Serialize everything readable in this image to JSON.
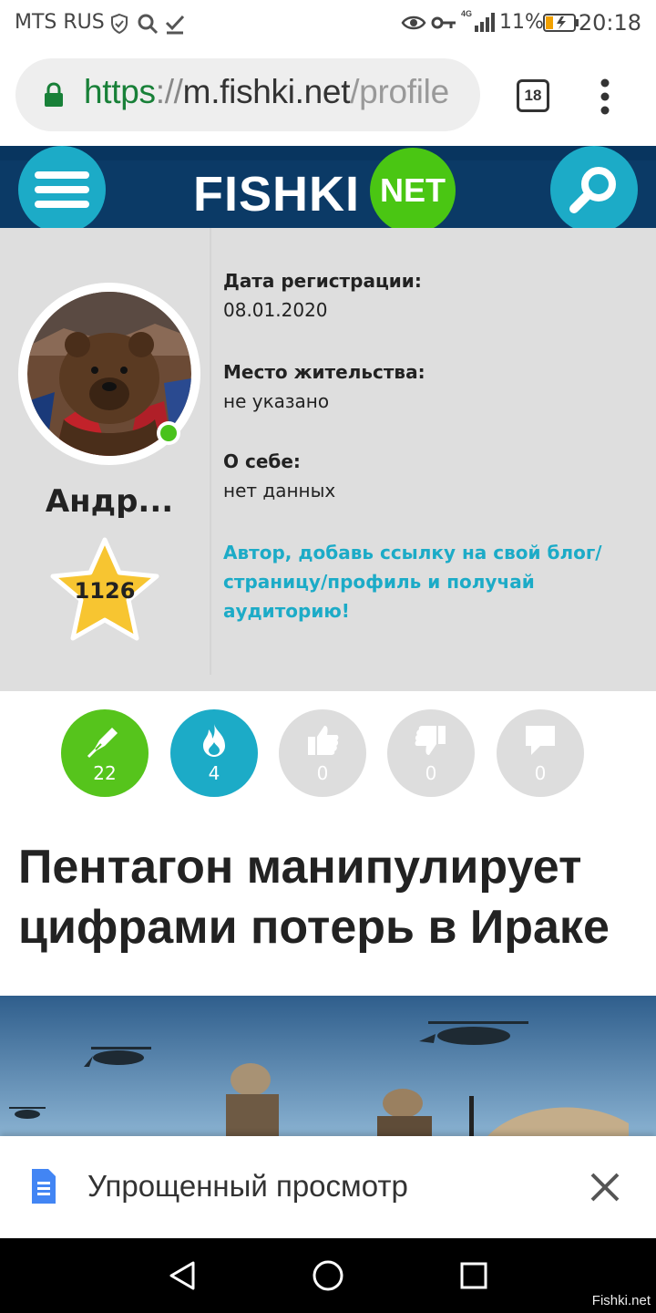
{
  "status_bar": {
    "carrier": "MTS RUS",
    "network": "4G",
    "battery_percent": "11%",
    "time": "20:18"
  },
  "browser": {
    "url_scheme": "https",
    "url_separator": "://",
    "url_host": "m.fishki.net",
    "url_path": "/profile",
    "tab_count": "18"
  },
  "site_header": {
    "logo_text": "FISHKI",
    "logo_badge": "NET"
  },
  "profile": {
    "username": "Андр...",
    "rating": "1126",
    "registration_label": "Дата регистрации:",
    "registration_value": "08.01.2020",
    "residence_label": "Место жительства:",
    "residence_value": "не указано",
    "about_label": "О себе:",
    "about_value": "нет данных",
    "blog_prompt": "Автор, добавь ссылку на свой блог/ страницу/профиль и получай аудиторию!"
  },
  "stats": [
    {
      "icon": "pen-icon",
      "count": "22",
      "color": "#56c41c"
    },
    {
      "icon": "flame-icon",
      "count": "4",
      "color": "#1cabc7"
    },
    {
      "icon": "thumbs-up-icon",
      "count": "0",
      "color": "#dddddd"
    },
    {
      "icon": "thumbs-down-icon",
      "count": "0",
      "color": "#dddddd"
    },
    {
      "icon": "comment-icon",
      "count": "0",
      "color": "#dddddd"
    }
  ],
  "article": {
    "title": "Пентагон манипулирует цифрами потерь в Ираке"
  },
  "simplified_view": {
    "label": "Упрощенный просмотр"
  },
  "watermark": "Fishki.net",
  "colors": {
    "site_header": "#0b3a66",
    "accent_teal": "#1cabc7",
    "accent_green": "#4ac613",
    "url_green": "#188038"
  }
}
